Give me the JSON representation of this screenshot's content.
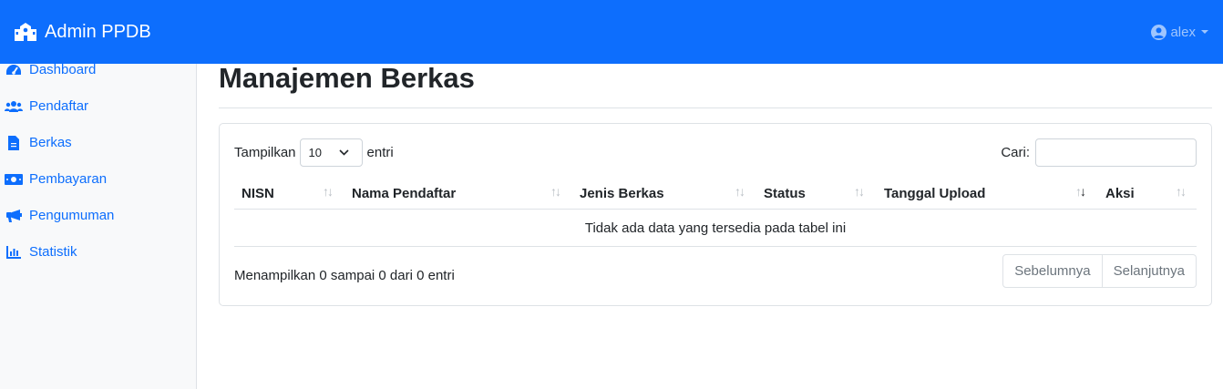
{
  "navbar": {
    "brand": "Admin PPDB",
    "user": "alex"
  },
  "sidebar": {
    "items": [
      {
        "label": "Dashboard",
        "icon": "tachometer-icon"
      },
      {
        "label": "Pendaftar",
        "icon": "users-icon"
      },
      {
        "label": "Berkas",
        "icon": "file-icon"
      },
      {
        "label": "Pembayaran",
        "icon": "money-icon"
      },
      {
        "label": "Pengumuman",
        "icon": "bullhorn-icon"
      },
      {
        "label": "Statistik",
        "icon": "bar-chart-icon"
      }
    ]
  },
  "main": {
    "title": "Manajemen Berkas",
    "table_controls": {
      "length_prefix": "Tampilkan",
      "length_value": "10",
      "length_suffix": "entri",
      "search_label": "Cari:",
      "search_value": ""
    },
    "table": {
      "columns": [
        "NISN",
        "Nama Pendaftar",
        "Jenis Berkas",
        "Status",
        "Tanggal Upload",
        "Aksi"
      ],
      "sorted_column": "Tanggal Upload",
      "empty_message": "Tidak ada data yang tersedia pada tabel ini"
    },
    "info": "Menampilkan 0 sampai 0 dari 0 entri",
    "pagination": {
      "prev": "Sebelumnya",
      "next": "Selanjutnya"
    }
  },
  "colors": {
    "primary": "#0d6efd",
    "sidebar_bg": "#f8f9fa",
    "border": "#dee2e6"
  }
}
